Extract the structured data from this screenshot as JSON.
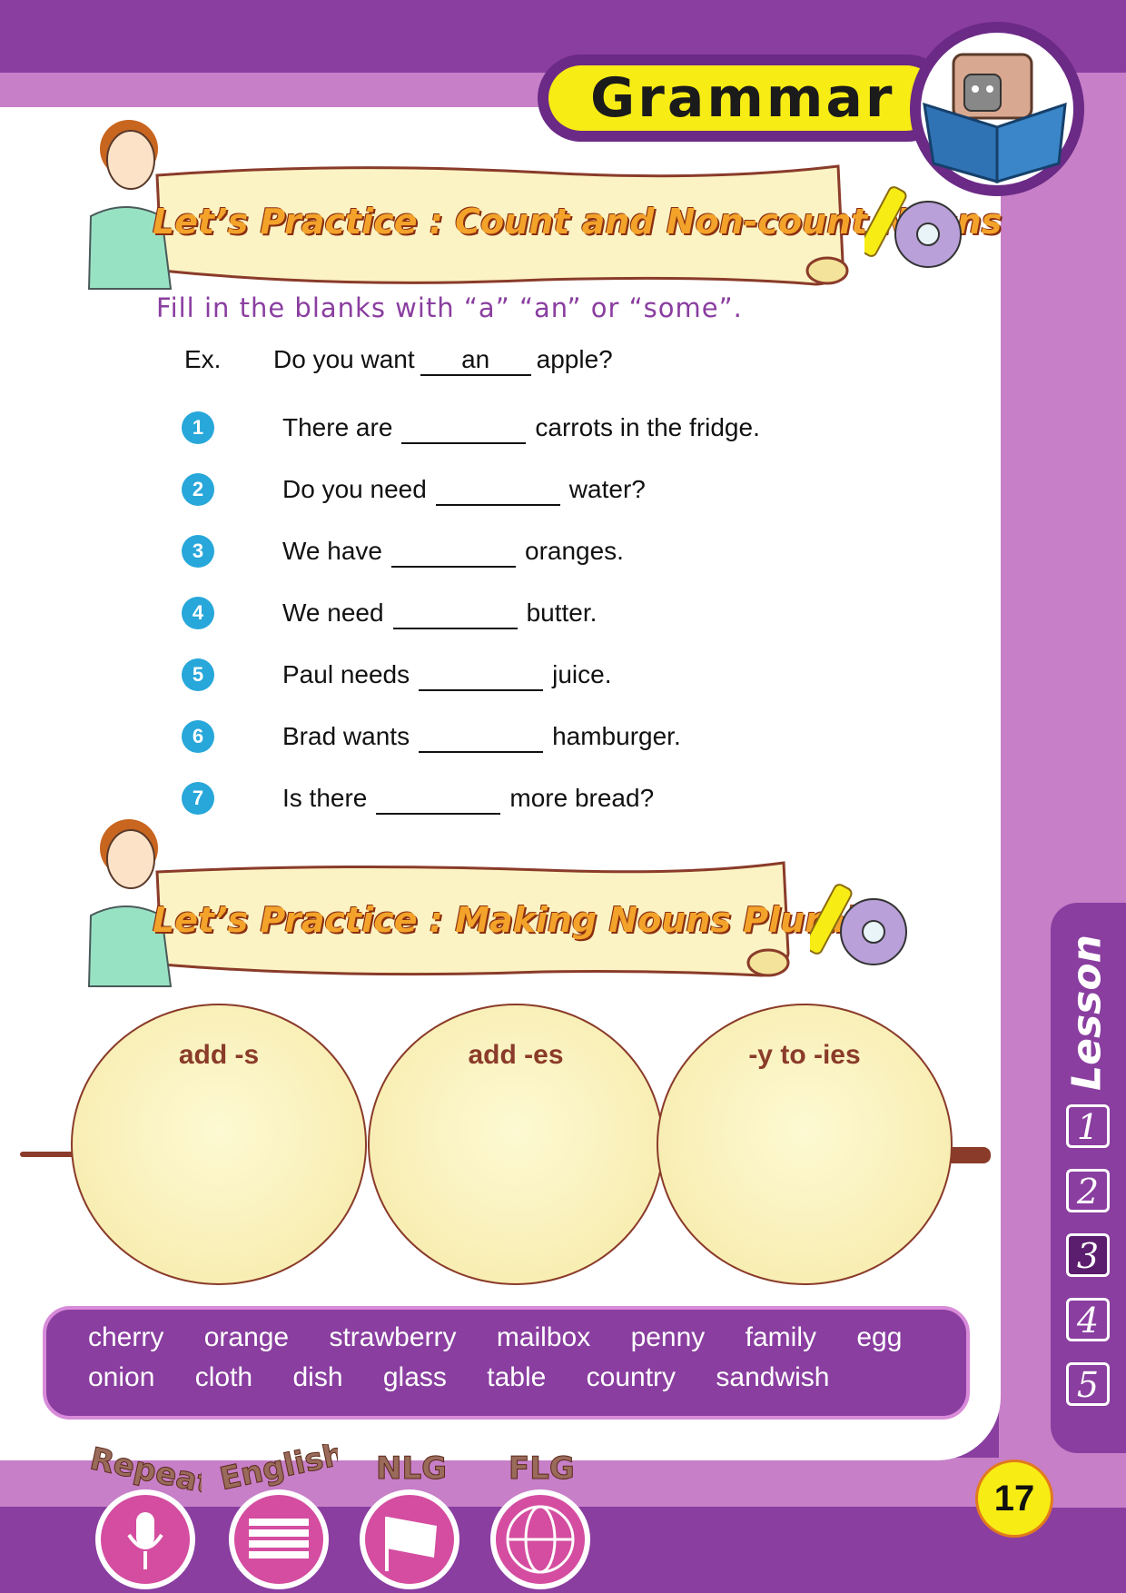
{
  "header": {
    "title": "Grammar"
  },
  "section1": {
    "banner": "Let’s Practice : Count and Non-count Nouns",
    "instruction": "Fill in the blanks with “a” “an” or “some”.",
    "example": {
      "label": "Ex.",
      "before": "Do you want",
      "answer": "an",
      "after": "apple?"
    },
    "questions": [
      {
        "num": "1",
        "before": "There are",
        "after": "carrots in the fridge."
      },
      {
        "num": "2",
        "before": "Do you need",
        "after": "water?"
      },
      {
        "num": "3",
        "before": "We have",
        "after": "oranges."
      },
      {
        "num": "4",
        "before": "We need",
        "after": "butter."
      },
      {
        "num": "5",
        "before": "Paul needs",
        "after": "juice."
      },
      {
        "num": "6",
        "before": "Brad wants",
        "after": "hamburger."
      },
      {
        "num": "7",
        "before": "Is there",
        "after": "more bread?"
      }
    ]
  },
  "section2": {
    "banner": "Let’s Practice : Making Nouns Plural",
    "categories": [
      "add -s",
      "add -es",
      "-y to -ies"
    ],
    "words_row1": [
      "cherry",
      "orange",
      "strawberry",
      "mailbox",
      "penny",
      "family",
      "egg"
    ],
    "words_row2": [
      "onion",
      "cloth",
      "dish",
      "glass",
      "table",
      "country",
      "sandwish"
    ]
  },
  "sidebar": {
    "label": "Lesson",
    "lessons": [
      "1",
      "2",
      "3",
      "4",
      "5"
    ],
    "active_lesson": "3"
  },
  "footer": {
    "page_number": "17",
    "logos": [
      "Repeat",
      "English",
      "NLG",
      "FLG"
    ]
  }
}
